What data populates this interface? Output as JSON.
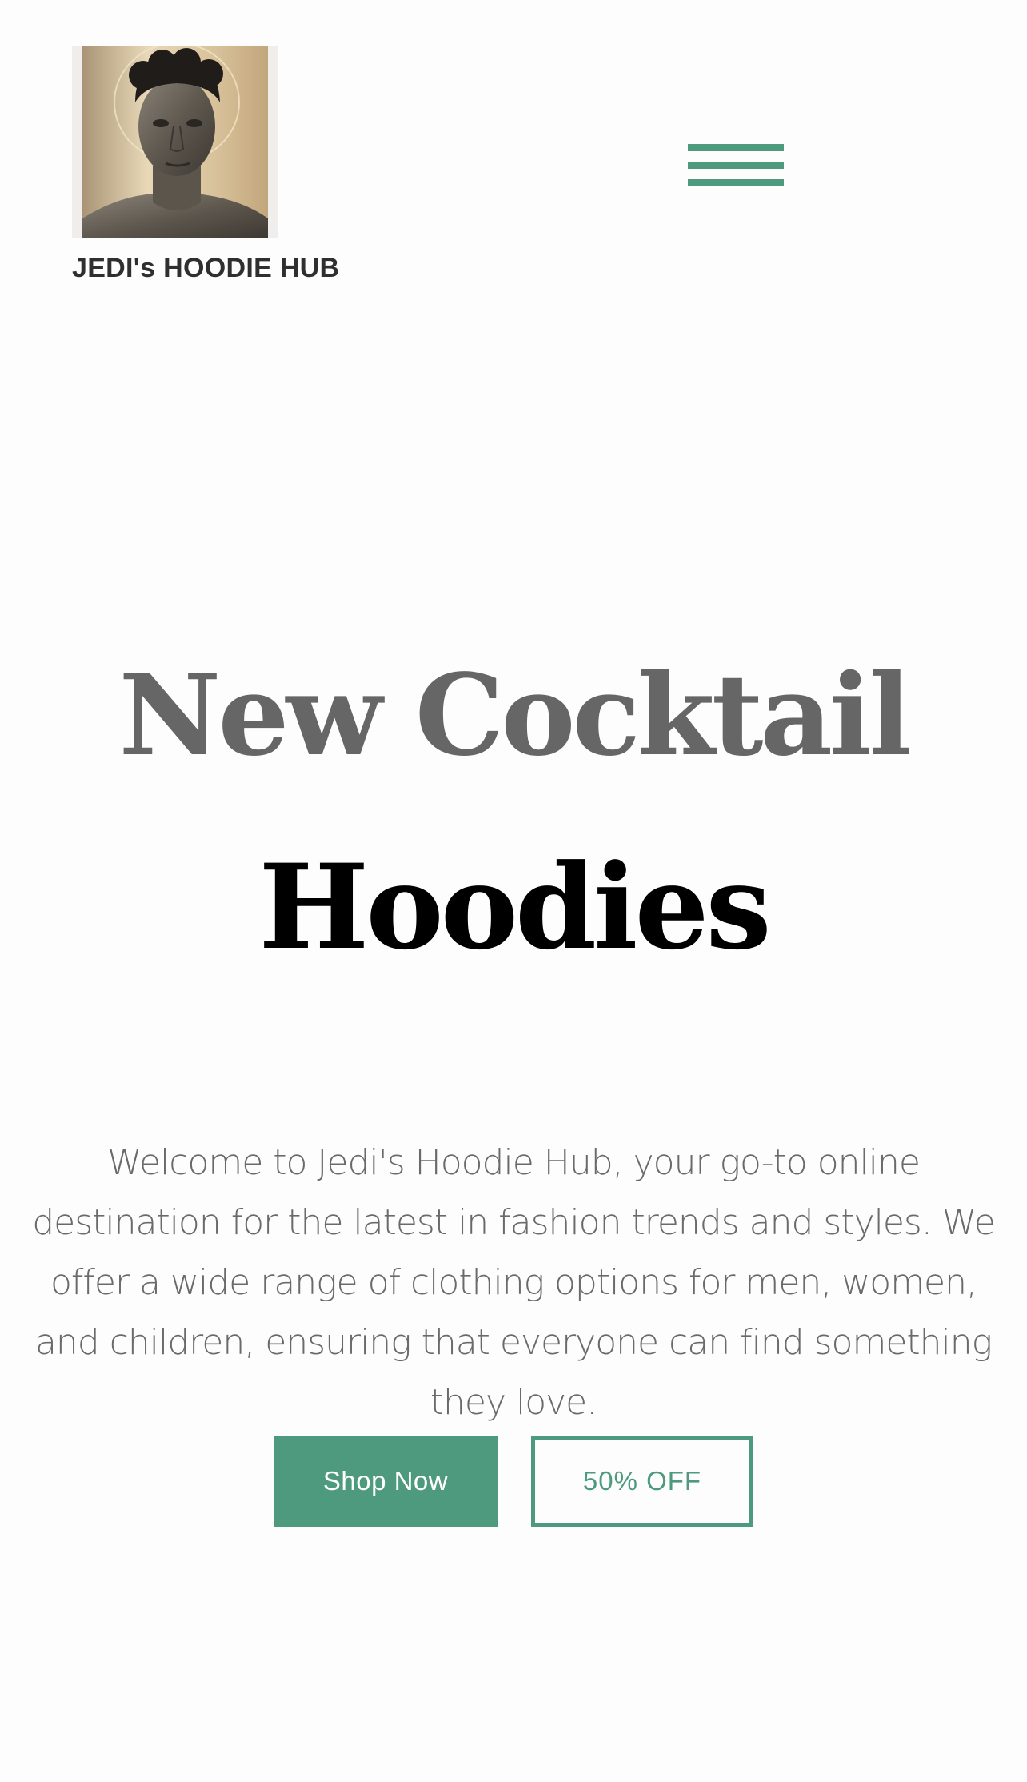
{
  "header": {
    "logo_icon": "portrait-logo-image",
    "brand_name": "JEDI's HOODIE HUB",
    "menu_icon": "hamburger-menu-icon"
  },
  "hero": {
    "title_line1": "New Cocktail",
    "title_line2": "Hoodies",
    "intro": "Welcome to Jedi's Hoodie Hub, your go-to online destination for the latest in fashion trends and styles. We offer a wide range of clothing options for men, women, and children, ensuring that everyone can find something they love.",
    "primary_button": "Shop Now",
    "secondary_button": "50% OFF"
  },
  "colors": {
    "accent": "#4e9a7f",
    "title_gray": "#666666",
    "title_black": "#000000",
    "text_gray": "#6a6a6a",
    "background": "#fdfdfd"
  }
}
